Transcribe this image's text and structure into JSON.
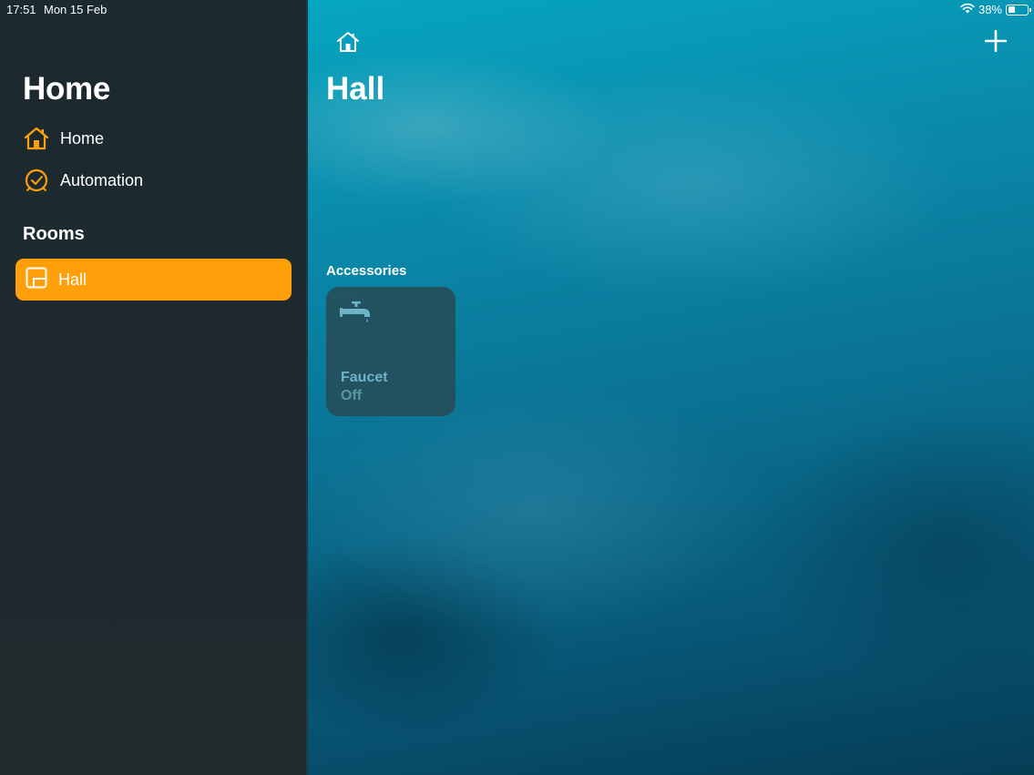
{
  "status_bar": {
    "time": "17:51",
    "date": "Mon 15 Feb",
    "battery_percent_text": "38%",
    "battery_level": 0.38,
    "icons": [
      "wifi-icon",
      "battery-icon"
    ]
  },
  "sidebar": {
    "title": "Home",
    "nav": [
      {
        "label": "Home",
        "icon": "house-icon"
      },
      {
        "label": "Automation",
        "icon": "clock-icon"
      }
    ],
    "rooms_heading": "Rooms",
    "rooms": [
      {
        "label": "Hall",
        "icon": "room-icon",
        "selected": true
      }
    ]
  },
  "main": {
    "title": "Hall",
    "home_button_icon": "house-icon",
    "add_button_icon": "plus-icon",
    "accessories_heading": "Accessories",
    "accessories": [
      {
        "name": "Faucet",
        "state": "Off",
        "icon": "faucet-icon"
      }
    ]
  },
  "colors": {
    "accent": "#ff9f0a",
    "sidebar_bg": "#1f2a2e",
    "tile_text": "#6fb3c8"
  }
}
